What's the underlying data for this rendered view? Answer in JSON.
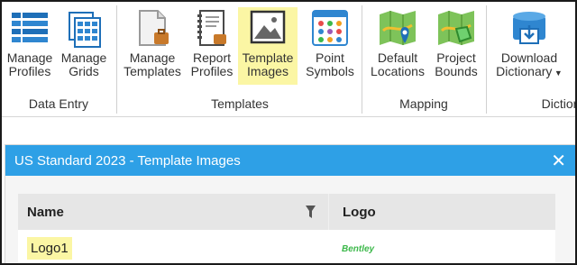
{
  "ribbon": {
    "buttons": [
      {
        "label": "Manage\nProfiles",
        "icon": "manage-profiles-icon"
      },
      {
        "label": "Manage\nGrids",
        "icon": "manage-grids-icon"
      },
      {
        "label": "Manage\nTemplates",
        "icon": "manage-templates-icon"
      },
      {
        "label": "Report\nProfiles",
        "icon": "report-profiles-icon"
      },
      {
        "label": "Template\nImages",
        "icon": "template-images-icon"
      },
      {
        "label": "Point\nSymbols",
        "icon": "point-symbols-icon"
      },
      {
        "label": "Default\nLocations",
        "icon": "default-locations-icon"
      },
      {
        "label": "Project\nBounds",
        "icon": "project-bounds-icon"
      },
      {
        "label": "Download\nDictionary",
        "icon": "download-dictionary-icon"
      }
    ],
    "groups": [
      "Data Entry",
      "Templates",
      "Mapping",
      "Diction"
    ],
    "selected": "Template Images",
    "colors": {
      "selected_bg": "#fbf6a4"
    }
  },
  "dialog": {
    "title": "US Standard 2023 - Template Images",
    "close_glyph": "✕",
    "title_color": "#2ea0e6",
    "columns": {
      "name": "Name",
      "logo": "Logo"
    },
    "rows": [
      {
        "name": "Logo1",
        "logo_text": "Bentley"
      }
    ]
  }
}
